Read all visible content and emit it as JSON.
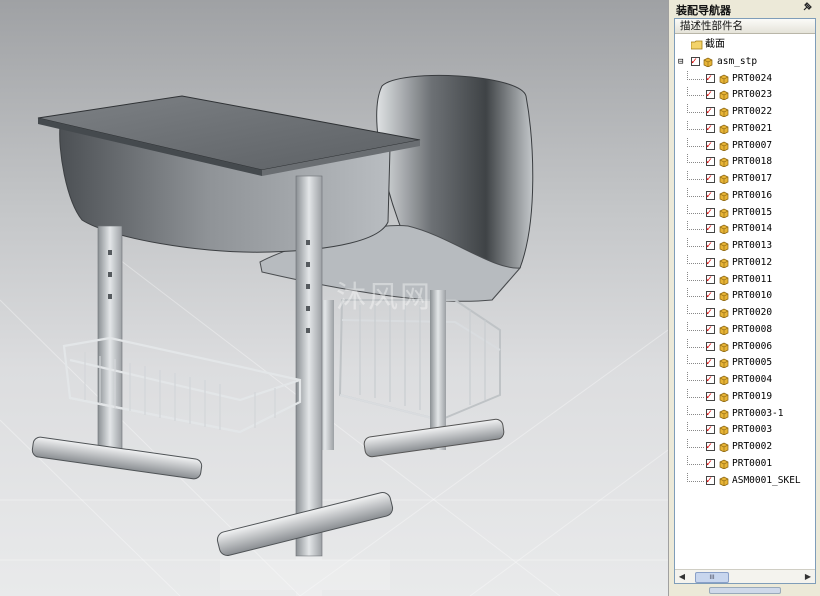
{
  "panel": {
    "title": "装配导航器",
    "pin_icon": "pin-icon",
    "column_header": "描述性部件名",
    "section_node": "截面",
    "root_node": "asm_stp",
    "expander": "⊟",
    "parts": [
      "PRT0024",
      "PRT0023",
      "PRT0022",
      "PRT0021",
      "PRT0007",
      "PRT0018",
      "PRT0017",
      "PRT0016",
      "PRT0015",
      "PRT0014",
      "PRT0013",
      "PRT0012",
      "PRT0011",
      "PRT0010",
      "PRT0020",
      "PRT0008",
      "PRT0006",
      "PRT0005",
      "PRT0004",
      "PRT0019",
      "PRT0003-1",
      "PRT0003",
      "PRT0002",
      "PRT0001",
      "ASM0001_SKEL"
    ]
  },
  "scrollbar": {
    "left_arrow": "◀",
    "right_arrow": "▶",
    "thumb_grip": "III"
  },
  "viewport": {
    "watermark": "沐风网"
  },
  "colors": {
    "part_icon": "#e7b437",
    "check": "#d00000",
    "background_top": "#9fa1a4",
    "background_bottom": "#e9eaeb"
  }
}
